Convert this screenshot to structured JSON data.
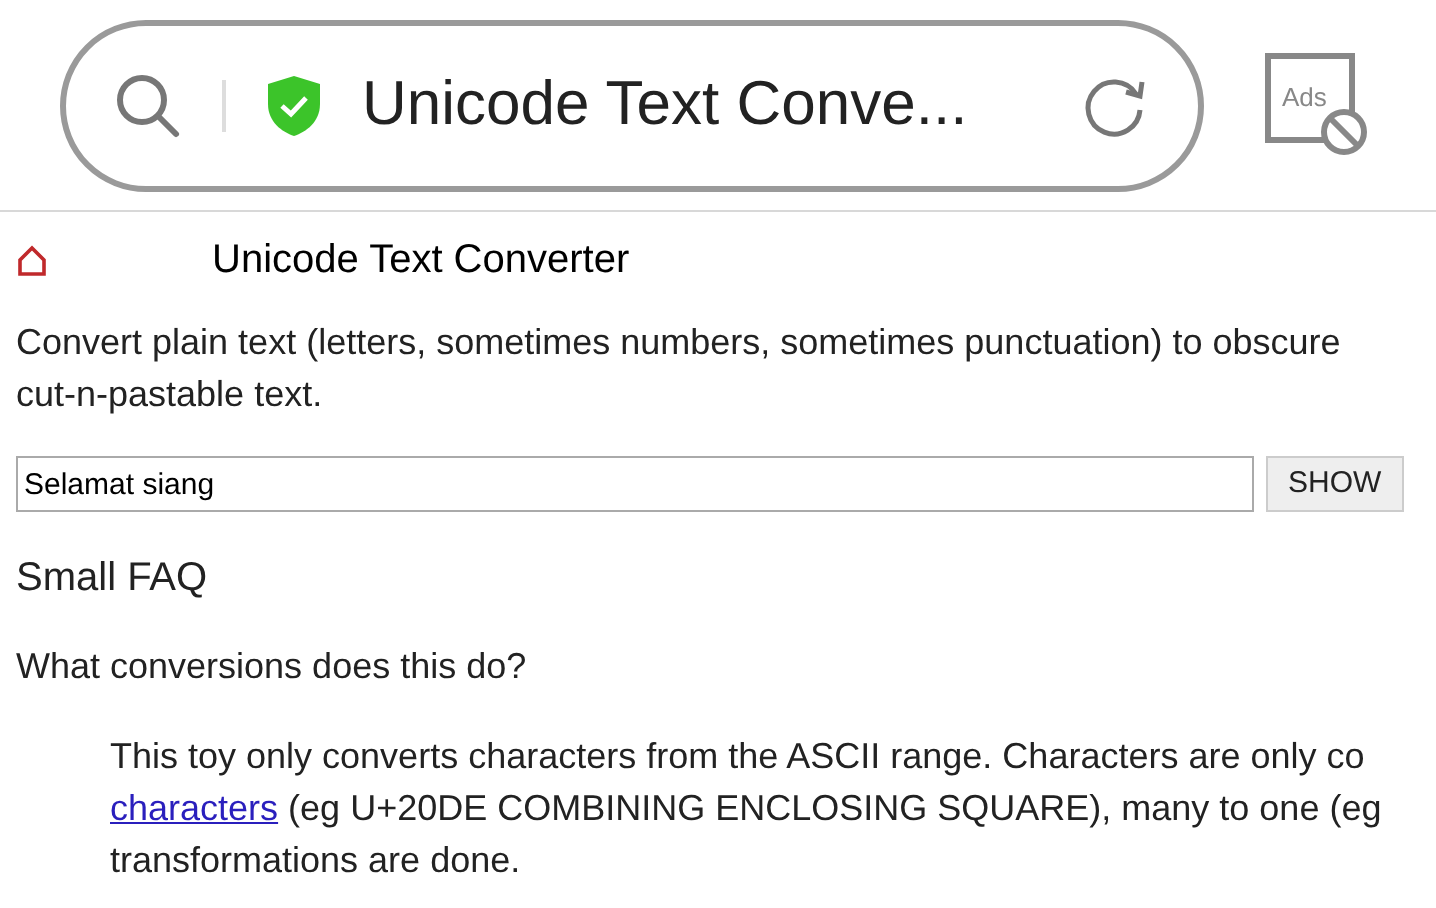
{
  "address_bar": {
    "title": "Unicode Text Conve...",
    "secure": true,
    "ad_block_label": "Ads"
  },
  "page": {
    "title": "Unicode Text Converter",
    "intro_lines": [
      "Convert plain text (letters, sometimes numbers, sometimes punctuation) to obscure",
      "cut-n-pastable text."
    ],
    "input": {
      "value": "Selamat siang"
    },
    "button": "SHOW",
    "faq_title": "Small FAQ",
    "question": "What conversions does this do?",
    "answer": [
      {
        "kind": "text",
        "text": "This toy only converts characters from the ASCII range. Characters are only co"
      },
      {
        "kind": "link",
        "link": "characters",
        "text": " (eg U+20DE COMBINING ENCLOSING SQUARE), many to one (eg"
      },
      {
        "kind": "text",
        "text": "transformations are done."
      }
    ]
  }
}
